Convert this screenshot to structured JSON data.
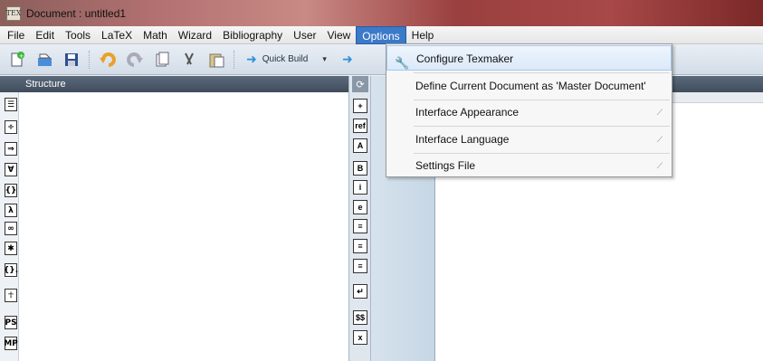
{
  "window": {
    "title": "Document : untitled1",
    "app_icon": "TEX"
  },
  "menubar": {
    "items": [
      {
        "label": "File"
      },
      {
        "label": "Edit"
      },
      {
        "label": "Tools"
      },
      {
        "label": "LaTeX"
      },
      {
        "label": "Math"
      },
      {
        "label": "Wizard"
      },
      {
        "label": "Bibliography"
      },
      {
        "label": "User"
      },
      {
        "label": "View"
      },
      {
        "label": "Options"
      },
      {
        "label": "Help"
      }
    ]
  },
  "toolbar": {
    "quick_build_label": "Quick Build"
  },
  "structure": {
    "header": "Structure"
  },
  "left_icons": [
    "☰",
    "÷",
    "⇒",
    "∀",
    "{}",
    "λ",
    "∞",
    "✱",
    "{}.",
    "☥",
    "PS",
    "MP"
  ],
  "mid_icons": [
    "+",
    "ref",
    "A",
    "B",
    "i",
    "e",
    "≡",
    "≡",
    "≡",
    "↵",
    "$$",
    "x"
  ],
  "options_menu": {
    "items": [
      {
        "label": "Configure Texmaker",
        "icon": "wrench-icon"
      },
      {
        "label": "Define Current Document as 'Master Document'"
      },
      {
        "label": "Interface Appearance",
        "submenu": true
      },
      {
        "label": "Interface Language",
        "submenu": true
      },
      {
        "label": "Settings File",
        "submenu": true
      }
    ]
  }
}
